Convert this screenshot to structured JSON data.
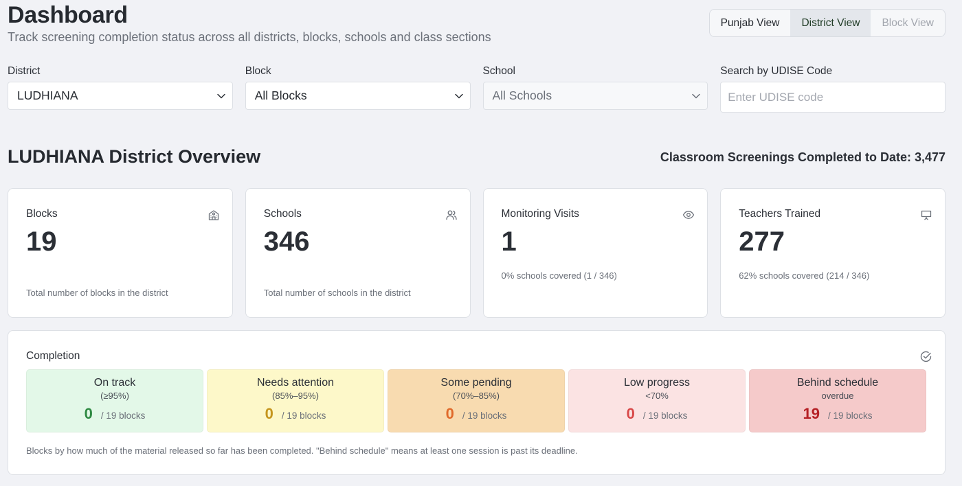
{
  "header": {
    "title": "Dashboard",
    "subtitle": "Track screening completion status across all districts, blocks, schools and class sections"
  },
  "view_toggle": {
    "punjab": "Punjab View",
    "district": "District View",
    "block": "Block View",
    "active": "district"
  },
  "filters": {
    "district": {
      "label": "District",
      "value": "LUDHIANA"
    },
    "block": {
      "label": "Block",
      "value": "All Blocks"
    },
    "school": {
      "label": "School",
      "value": "All Schools"
    },
    "udise": {
      "label": "Search by UDISE Code",
      "placeholder": "Enter UDISE code",
      "value": ""
    }
  },
  "overview": {
    "title": "LUDHIANA District Overview",
    "screenings": "Classroom Screenings Completed to Date: 3,477"
  },
  "cards": {
    "blocks": {
      "label": "Blocks",
      "value": "19",
      "note": "Total number of blocks in the district",
      "icon": "school-building-icon"
    },
    "schools": {
      "label": "Schools",
      "value": "346",
      "note": "Total number of schools in the district",
      "icon": "users-icon"
    },
    "visits": {
      "label": "Monitoring Visits",
      "value": "1",
      "note": "0% schools covered (1 / 346)",
      "icon": "eye-icon"
    },
    "teachers": {
      "label": "Teachers Trained",
      "value": "277",
      "note": "62% schools covered (214 / 346)",
      "icon": "presentation-icon"
    }
  },
  "completion": {
    "title": "Completion",
    "icon": "check-circle-icon",
    "tiles": [
      {
        "name": "On track",
        "range": "(≥95%)",
        "count": "0",
        "total": "/ 19 blocks",
        "bg": "#e3f8e8",
        "color": "#2f8a43"
      },
      {
        "name": "Needs attention",
        "range": "(85%–95%)",
        "count": "0",
        "total": "/ 19 blocks",
        "bg": "#fdf8c9",
        "color": "#c5951d"
      },
      {
        "name": "Some pending",
        "range": "(70%–85%)",
        "count": "0",
        "total": "/ 19 blocks",
        "bg": "#f8dbb0",
        "color": "#e06a2b"
      },
      {
        "name": "Low progress",
        "range": "<70%",
        "count": "0",
        "total": "/ 19 blocks",
        "bg": "#fbe3e3",
        "color": "#d84848"
      },
      {
        "name": "Behind schedule",
        "range": "overdue",
        "count": "19",
        "total": "/ 19 blocks",
        "bg": "#f5caca",
        "color": "#b52025"
      }
    ],
    "footnote": "Blocks by how much of the material released so far has been completed. \"Behind schedule\" means at least one session is past its deadline."
  }
}
